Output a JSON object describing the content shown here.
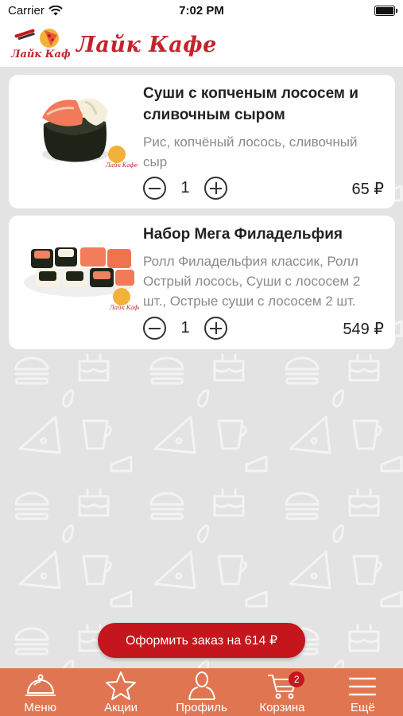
{
  "status_bar": {
    "carrier": "Carrier",
    "time": "7:02 PM"
  },
  "header": {
    "brand": "Лайк Кафе",
    "logo_text": "Лайк Кафе"
  },
  "cart_items": [
    {
      "title": "Суши с копченым лососем и сливочным сыром",
      "description": "Рис, копчёный лосось, сливочный сыр",
      "quantity": "1",
      "price": "65 ₽"
    },
    {
      "title": "Набор Мега Филадельфия",
      "description": "Ролл Филадельфия классик, Ролл Острый лосось, Суши с лососем 2 шт., Острые суши с лососем 2 шт.",
      "quantity": "1",
      "price": "549 ₽"
    }
  ],
  "order_button": {
    "label": "Оформить заказ на 614 ₽"
  },
  "tabbar": {
    "tabs": [
      {
        "label": "Меню",
        "icon": "cloche-icon"
      },
      {
        "label": "Акции",
        "icon": "star-icon"
      },
      {
        "label": "Профиль",
        "icon": "person-icon"
      },
      {
        "label": "Корзина",
        "icon": "cart-icon",
        "badge": "2"
      },
      {
        "label": "Ещё",
        "icon": "menu-icon"
      }
    ]
  },
  "colors": {
    "brand_red": "#c4161c",
    "tabbar_bg": "#e07651",
    "background": "#e3e3e3"
  }
}
